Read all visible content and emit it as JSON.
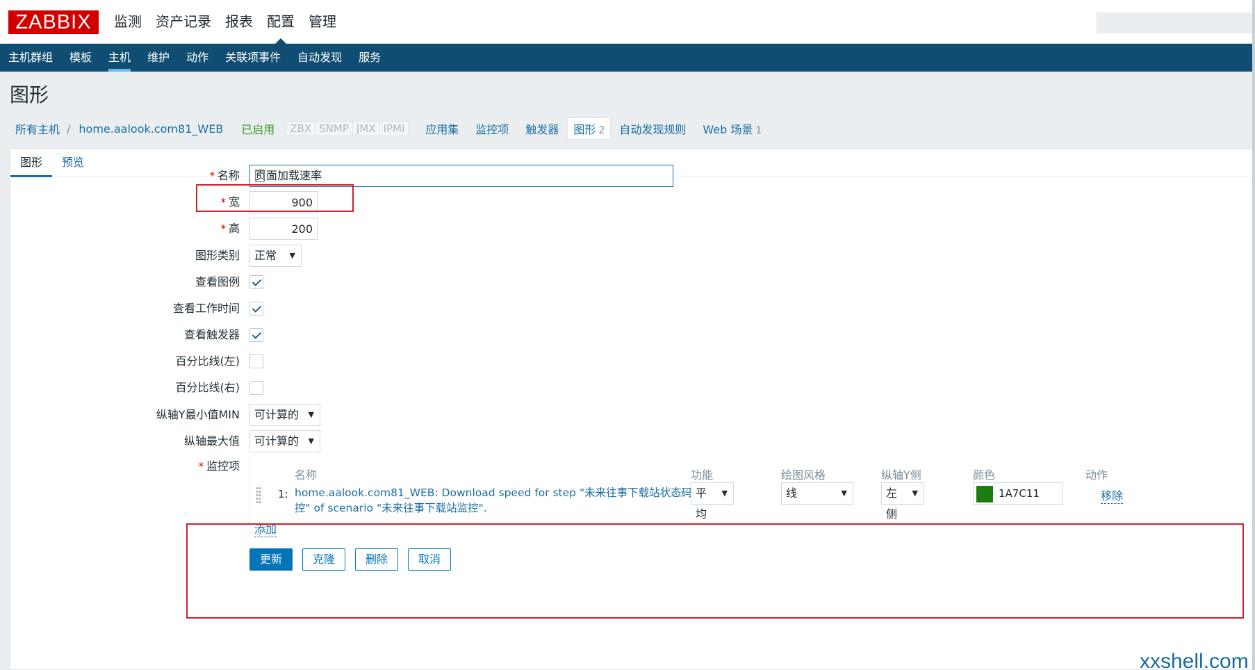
{
  "logo": "ZABBIX",
  "main_menu": [
    "监测",
    "资产记录",
    "报表",
    "配置",
    "管理"
  ],
  "main_menu_selected": "配置",
  "sub_menu": [
    "主机群组",
    "模板",
    "主机",
    "维护",
    "动作",
    "关联项事件",
    "自动发现",
    "服务"
  ],
  "sub_menu_selected": "主机",
  "page_title": "图形",
  "breadcrumb": {
    "all_hosts": "所有主机",
    "separator": "/",
    "host": "home.aalook.com81_WEB",
    "status": "已启用",
    "protocols": [
      "ZBX",
      "SNMP",
      "JMX",
      "IPMI"
    ],
    "links": [
      {
        "label": "应用集",
        "count": ""
      },
      {
        "label": "监控项",
        "count": ""
      },
      {
        "label": "触发器",
        "count": ""
      },
      {
        "label": "图形",
        "count": "2"
      },
      {
        "label": "自动发现规则",
        "count": ""
      },
      {
        "label": "Web 场景",
        "count": "1"
      }
    ]
  },
  "tabs": [
    "图形",
    "预览"
  ],
  "form": {
    "name_label": "名称",
    "name_value": "页面加载速率",
    "width_label": "宽",
    "width_value": "900",
    "height_label": "高",
    "height_value": "200",
    "graph_type_label": "图形类别",
    "graph_type_value": "正常",
    "show_legend_label": "查看图例",
    "show_legend": true,
    "show_worktime_label": "查看工作时间",
    "show_worktime": true,
    "show_triggers_label": "查看触发器",
    "show_triggers": true,
    "percentile_left_label": "百分比线(左)",
    "percentile_left": false,
    "percentile_right_label": "百分比线(右)",
    "percentile_right": false,
    "ymin_label": "纵轴Y最小值MIN",
    "ymin_value": "可计算的",
    "ymax_label": "纵轴最大值",
    "ymax_value": "可计算的",
    "required_mark": "*"
  },
  "items_section": {
    "label": "监控项",
    "headers": {
      "name": "名称",
      "function": "功能",
      "drawstyle": "绘图风格",
      "yaxis": "纵轴Y侧",
      "color": "颜色",
      "action": "动作"
    },
    "rows": [
      {
        "index": "1:",
        "name": "home.aalook.com81_WEB: Download speed for step \"未来往事下载站状态码监控\" of scenario \"未来往事下载站监控\".",
        "function": "平均",
        "drawstyle": "线",
        "yaxis": "左侧",
        "color": "1A7C11",
        "color_hex": "#1A7C11",
        "remove": "移除"
      }
    ],
    "add_label": "添加"
  },
  "buttons": {
    "update": "更新",
    "clone": "克隆",
    "delete": "删除",
    "cancel": "取消"
  },
  "watermark": "xxshell.com",
  "colors": {
    "accent": "#0f4e72",
    "link": "#1a6da1",
    "highlight_box": "#d21f26",
    "logo": "#d40000"
  }
}
